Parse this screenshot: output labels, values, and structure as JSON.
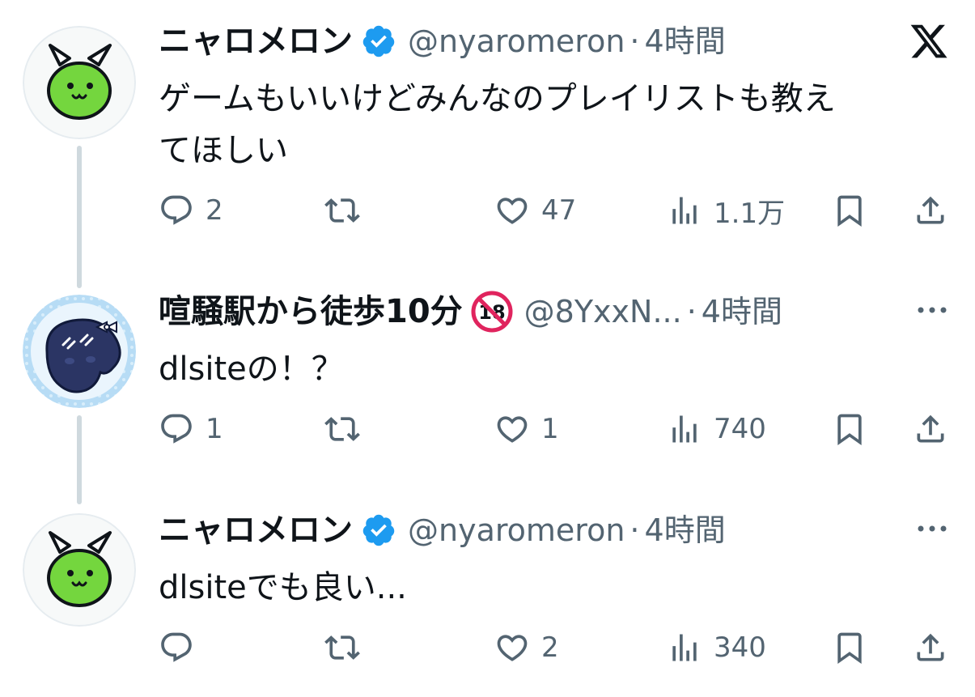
{
  "tweets": [
    {
      "display_name": "ニャロメロン",
      "handle": "@nyaromeron",
      "dot": "·",
      "time": "4時間",
      "text_lines": [
        "ゲームもいいけどみんなのプレイリストも教え",
        "てほしい"
      ],
      "replies": "2",
      "retweets": "",
      "likes": "47",
      "views": "1.1万"
    },
    {
      "display_name": "喧騒駅から徒歩10分",
      "handle": "@8YxxN...",
      "dot": "·",
      "time": "4時間",
      "text_lines": [
        "dlsiteの！？"
      ],
      "replies": "1",
      "retweets": "",
      "likes": "1",
      "views": "740"
    },
    {
      "display_name": "ニャロメロン",
      "handle": "@nyaromeron",
      "dot": "·",
      "time": "4時間",
      "text_lines": [
        "dlsiteでも良い..."
      ],
      "replies": "",
      "retweets": "",
      "likes": "2",
      "views": "340"
    }
  ],
  "icons": {
    "verified": "verified-badge-icon",
    "adult": "adult-18-icon",
    "x_logo": "x-logo-icon",
    "more": "more-icon",
    "reply": "reply-icon",
    "retweet": "retweet-icon",
    "like": "heart-icon",
    "views": "views-icon",
    "bookmark": "bookmark-icon",
    "share": "share-icon"
  },
  "colors": {
    "text": "#0f1419",
    "secondary": "#536471",
    "verified": "#1d9bf0",
    "thread_line": "#cfd9de",
    "avatar_green": "#74d63e",
    "avatar_navy": "#2b3564"
  }
}
